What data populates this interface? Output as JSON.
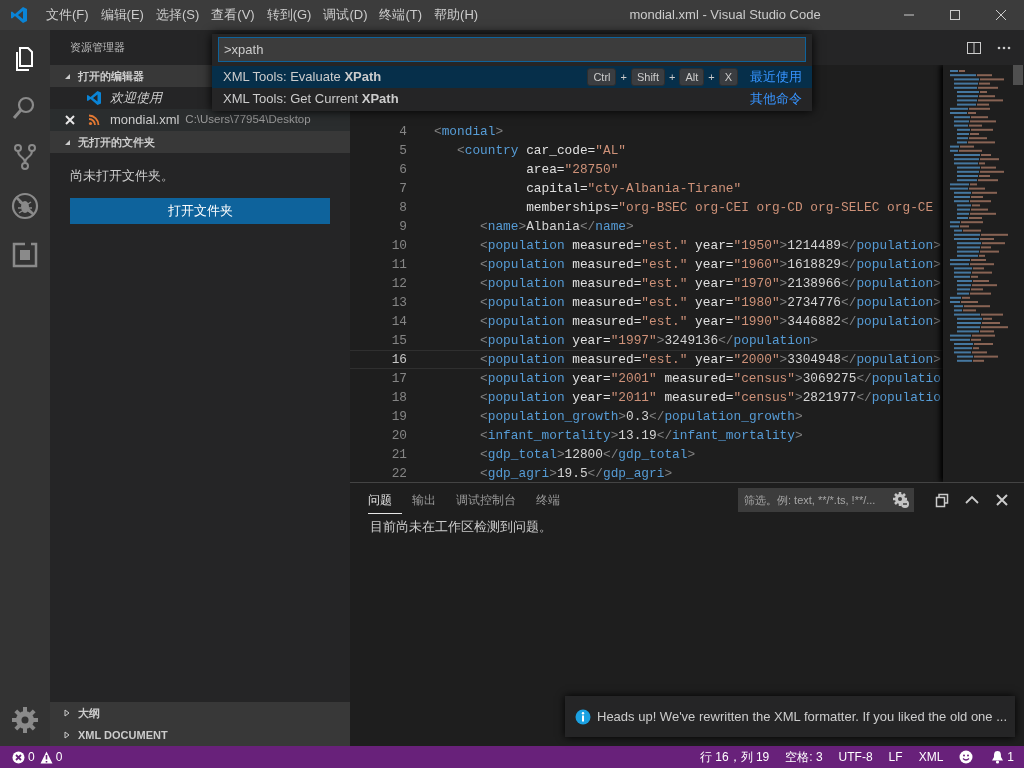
{
  "title_bar": {
    "menus": [
      "文件(F)",
      "编辑(E)",
      "选择(S)",
      "查看(V)",
      "转到(G)",
      "调试(D)",
      "终端(T)",
      "帮助(H)"
    ],
    "title": "mondial.xml - Visual Studio Code"
  },
  "activity_bar": {
    "items": [
      {
        "kind": "explorer",
        "selected": true
      },
      {
        "kind": "search",
        "selected": false
      },
      {
        "kind": "source_control",
        "selected": false
      },
      {
        "kind": "debug",
        "selected": false
      },
      {
        "kind": "extensions",
        "selected": false
      }
    ],
    "bottom_items": [
      {
        "kind": "settings",
        "selected": false
      }
    ]
  },
  "sidebar": {
    "title": "资源管理器",
    "open_editors": {
      "title": "打开的编辑器",
      "expanded": true,
      "items": [
        {
          "kind": "welcome",
          "name": "欢迎使用",
          "preview": true,
          "hovered": false
        },
        {
          "kind": "xml",
          "name": "mondial.xml",
          "path": "C:\\Users\\77954\\Desktop",
          "preview": false,
          "hovered": true
        }
      ]
    },
    "folder": {
      "title": "无打开的文件夹",
      "expanded": true,
      "message": "尚未打开文件夹。",
      "button": "打开文件夹"
    },
    "bottom_sections": [
      {
        "title": "大纲",
        "expanded": false
      },
      {
        "title": "XML DOCUMENT",
        "expanded": false
      }
    ]
  },
  "command_palette": {
    "query": ">xpath",
    "items": [
      {
        "label": "XML Tools: Evaluate **XPath**",
        "selected": true,
        "keybinding": [
          {
            "kind": "key",
            "text": "Ctrl"
          },
          {
            "kind": "sep",
            "text": "+"
          },
          {
            "kind": "key",
            "text": "Shift"
          },
          {
            "kind": "sep",
            "text": "+"
          },
          {
            "kind": "key",
            "text": "Alt"
          },
          {
            "kind": "sep",
            "text": "+"
          },
          {
            "kind": "key",
            "text": "X"
          }
        ],
        "group": "最近使用"
      },
      {
        "label": "XML Tools: Get Current **XPath**",
        "selected": false,
        "group": "其他命令"
      }
    ]
  },
  "editor": {
    "lines": [
      {
        "number": "4",
        "current": false,
        "tokens": [
          {
            "kind": "punct",
            "text": "<"
          },
          {
            "kind": "tag",
            "text": "mondial"
          },
          {
            "kind": "punct",
            "text": ">"
          }
        ]
      },
      {
        "number": "5",
        "current": false,
        "tokens": [
          {
            "kind": "punct",
            "text": "   <"
          },
          {
            "kind": "tag",
            "text": "country"
          },
          {
            "kind": "attr",
            "text": " car_code="
          },
          {
            "kind": "value",
            "text": "\"AL\""
          }
        ]
      },
      {
        "number": "6",
        "current": false,
        "tokens": [
          {
            "kind": "attr",
            "text": "            area="
          },
          {
            "kind": "value",
            "text": "\"28750\""
          }
        ]
      },
      {
        "number": "7",
        "current": false,
        "tokens": [
          {
            "kind": "attr",
            "text": "            capital="
          },
          {
            "kind": "value",
            "text": "\"cty-Albania-Tirane\""
          }
        ]
      },
      {
        "number": "8",
        "current": false,
        "tokens": [
          {
            "kind": "attr",
            "text": "            memberships="
          },
          {
            "kind": "value",
            "text": "\"org-BSEC org-CEI org-CD org-SELEC org-CE"
          }
        ]
      },
      {
        "number": "9",
        "current": false,
        "tokens": [
          {
            "kind": "punct",
            "text": "      <"
          },
          {
            "kind": "tag",
            "text": "name"
          },
          {
            "kind": "punct",
            "text": ">"
          },
          {
            "kind": "text",
            "text": "Albania"
          },
          {
            "kind": "punct",
            "text": "</"
          },
          {
            "kind": "tag",
            "text": "name"
          },
          {
            "kind": "punct",
            "text": ">"
          }
        ]
      },
      {
        "number": "10",
        "current": false,
        "tokens": [
          {
            "kind": "punct",
            "text": "      <"
          },
          {
            "kind": "tag",
            "text": "population"
          },
          {
            "kind": "attr",
            "text": " measured="
          },
          {
            "kind": "value",
            "text": "\"est.\""
          },
          {
            "kind": "attr",
            "text": " year="
          },
          {
            "kind": "value",
            "text": "\"1950\""
          },
          {
            "kind": "punct",
            "text": ">"
          },
          {
            "kind": "text",
            "text": "1214489"
          },
          {
            "kind": "punct",
            "text": "</"
          },
          {
            "kind": "tag",
            "text": "population"
          },
          {
            "kind": "punct",
            "text": ">"
          }
        ]
      },
      {
        "number": "11",
        "current": false,
        "tokens": [
          {
            "kind": "punct",
            "text": "      <"
          },
          {
            "kind": "tag",
            "text": "population"
          },
          {
            "kind": "attr",
            "text": " measured="
          },
          {
            "kind": "value",
            "text": "\"est.\""
          },
          {
            "kind": "attr",
            "text": " year="
          },
          {
            "kind": "value",
            "text": "\"1960\""
          },
          {
            "kind": "punct",
            "text": ">"
          },
          {
            "kind": "text",
            "text": "1618829"
          },
          {
            "kind": "punct",
            "text": "</"
          },
          {
            "kind": "tag",
            "text": "population"
          },
          {
            "kind": "punct",
            "text": ">"
          }
        ]
      },
      {
        "number": "12",
        "current": false,
        "tokens": [
          {
            "kind": "punct",
            "text": "      <"
          },
          {
            "kind": "tag",
            "text": "population"
          },
          {
            "kind": "attr",
            "text": " measured="
          },
          {
            "kind": "value",
            "text": "\"est.\""
          },
          {
            "kind": "attr",
            "text": " year="
          },
          {
            "kind": "value",
            "text": "\"1970\""
          },
          {
            "kind": "punct",
            "text": ">"
          },
          {
            "kind": "text",
            "text": "2138966"
          },
          {
            "kind": "punct",
            "text": "</"
          },
          {
            "kind": "tag",
            "text": "population"
          },
          {
            "kind": "punct",
            "text": ">"
          }
        ]
      },
      {
        "number": "13",
        "current": false,
        "tokens": [
          {
            "kind": "punct",
            "text": "      <"
          },
          {
            "kind": "tag",
            "text": "population"
          },
          {
            "kind": "attr",
            "text": " measured="
          },
          {
            "kind": "value",
            "text": "\"est.\""
          },
          {
            "kind": "attr",
            "text": " year="
          },
          {
            "kind": "value",
            "text": "\"1980\""
          },
          {
            "kind": "punct",
            "text": ">"
          },
          {
            "kind": "text",
            "text": "2734776"
          },
          {
            "kind": "punct",
            "text": "</"
          },
          {
            "kind": "tag",
            "text": "population"
          },
          {
            "kind": "punct",
            "text": ">"
          }
        ]
      },
      {
        "number": "14",
        "current": false,
        "tokens": [
          {
            "kind": "punct",
            "text": "      <"
          },
          {
            "kind": "tag",
            "text": "population"
          },
          {
            "kind": "attr",
            "text": " measured="
          },
          {
            "kind": "value",
            "text": "\"est.\""
          },
          {
            "kind": "attr",
            "text": " year="
          },
          {
            "kind": "value",
            "text": "\"1990\""
          },
          {
            "kind": "punct",
            "text": ">"
          },
          {
            "kind": "text",
            "text": "3446882"
          },
          {
            "kind": "punct",
            "text": "</"
          },
          {
            "kind": "tag",
            "text": "population"
          },
          {
            "kind": "punct",
            "text": ">"
          }
        ]
      },
      {
        "number": "15",
        "current": false,
        "tokens": [
          {
            "kind": "punct",
            "text": "      <"
          },
          {
            "kind": "tag",
            "text": "population"
          },
          {
            "kind": "attr",
            "text": " year="
          },
          {
            "kind": "value",
            "text": "\"1997\""
          },
          {
            "kind": "punct",
            "text": ">"
          },
          {
            "kind": "text",
            "text": "3249136"
          },
          {
            "kind": "punct",
            "text": "</"
          },
          {
            "kind": "tag",
            "text": "population"
          },
          {
            "kind": "punct",
            "text": ">"
          }
        ]
      },
      {
        "number": "16",
        "current": true,
        "tokens": [
          {
            "kind": "punct",
            "text": "      <"
          },
          {
            "kind": "tag",
            "text": "population"
          },
          {
            "kind": "attr",
            "text": " measured="
          },
          {
            "kind": "value",
            "text": "\"est.\""
          },
          {
            "kind": "attr",
            "text": " year="
          },
          {
            "kind": "value",
            "text": "\"2000\""
          },
          {
            "kind": "punct",
            "text": ">"
          },
          {
            "kind": "text",
            "text": "3304948"
          },
          {
            "kind": "punct",
            "text": "</"
          },
          {
            "kind": "tag",
            "text": "population"
          },
          {
            "kind": "punct",
            "text": ">"
          }
        ]
      },
      {
        "number": "17",
        "current": false,
        "tokens": [
          {
            "kind": "punct",
            "text": "      <"
          },
          {
            "kind": "tag",
            "text": "population"
          },
          {
            "kind": "attr",
            "text": " year="
          },
          {
            "kind": "value",
            "text": "\"2001\""
          },
          {
            "kind": "attr",
            "text": " measured="
          },
          {
            "kind": "value",
            "text": "\"census\""
          },
          {
            "kind": "punct",
            "text": ">"
          },
          {
            "kind": "text",
            "text": "3069275"
          },
          {
            "kind": "punct",
            "text": "</"
          },
          {
            "kind": "tag",
            "text": "populatio"
          }
        ]
      },
      {
        "number": "18",
        "current": false,
        "tokens": [
          {
            "kind": "punct",
            "text": "      <"
          },
          {
            "kind": "tag",
            "text": "population"
          },
          {
            "kind": "attr",
            "text": " year="
          },
          {
            "kind": "value",
            "text": "\"2011\""
          },
          {
            "kind": "attr",
            "text": " measured="
          },
          {
            "kind": "value",
            "text": "\"census\""
          },
          {
            "kind": "punct",
            "text": ">"
          },
          {
            "kind": "text",
            "text": "2821977"
          },
          {
            "kind": "punct",
            "text": "</"
          },
          {
            "kind": "tag",
            "text": "populatio"
          }
        ]
      },
      {
        "number": "19",
        "current": false,
        "tokens": [
          {
            "kind": "punct",
            "text": "      <"
          },
          {
            "kind": "tag",
            "text": "population_growth"
          },
          {
            "kind": "punct",
            "text": ">"
          },
          {
            "kind": "text",
            "text": "0.3"
          },
          {
            "kind": "punct",
            "text": "</"
          },
          {
            "kind": "tag",
            "text": "population_growth"
          },
          {
            "kind": "punct",
            "text": ">"
          }
        ]
      },
      {
        "number": "20",
        "current": false,
        "tokens": [
          {
            "kind": "punct",
            "text": "      <"
          },
          {
            "kind": "tag",
            "text": "infant_mortality"
          },
          {
            "kind": "punct",
            "text": ">"
          },
          {
            "kind": "text",
            "text": "13.19"
          },
          {
            "kind": "punct",
            "text": "</"
          },
          {
            "kind": "tag",
            "text": "infant_mortality"
          },
          {
            "kind": "punct",
            "text": ">"
          }
        ]
      },
      {
        "number": "21",
        "current": false,
        "tokens": [
          {
            "kind": "punct",
            "text": "      <"
          },
          {
            "kind": "tag",
            "text": "gdp_total"
          },
          {
            "kind": "punct",
            "text": ">"
          },
          {
            "kind": "text",
            "text": "12800"
          },
          {
            "kind": "punct",
            "text": "</"
          },
          {
            "kind": "tag",
            "text": "gdp_total"
          },
          {
            "kind": "punct",
            "text": ">"
          }
        ]
      },
      {
        "number": "22",
        "current": false,
        "tokens": [
          {
            "kind": "punct",
            "text": "      <"
          },
          {
            "kind": "tag",
            "text": "gdp_agri"
          },
          {
            "kind": "punct",
            "text": ">"
          },
          {
            "kind": "text",
            "text": "19.5"
          },
          {
            "kind": "punct",
            "text": "</"
          },
          {
            "kind": "tag",
            "text": "gdp_agri"
          },
          {
            "kind": "punct",
            "text": ">"
          }
        ]
      }
    ]
  },
  "panel": {
    "tabs": [
      {
        "label": "问题",
        "selected": true
      },
      {
        "label": "输出",
        "selected": false
      },
      {
        "label": "调试控制台",
        "selected": false
      },
      {
        "label": "终端",
        "selected": false
      }
    ],
    "filter": {
      "placeholder": "筛选。例: text, **/*.ts, !**/..."
    },
    "message": "目前尚未在工作区检测到问题。"
  },
  "notification": {
    "message": "Heads up! We've rewritten the XML formatter. If you liked the old one ..."
  },
  "status_bar": {
    "errors": "0",
    "warnings": "0",
    "items": [
      "行 16，列 19",
      "空格: 3",
      "UTF-8",
      "LF",
      "XML"
    ],
    "notifications": "1"
  }
}
